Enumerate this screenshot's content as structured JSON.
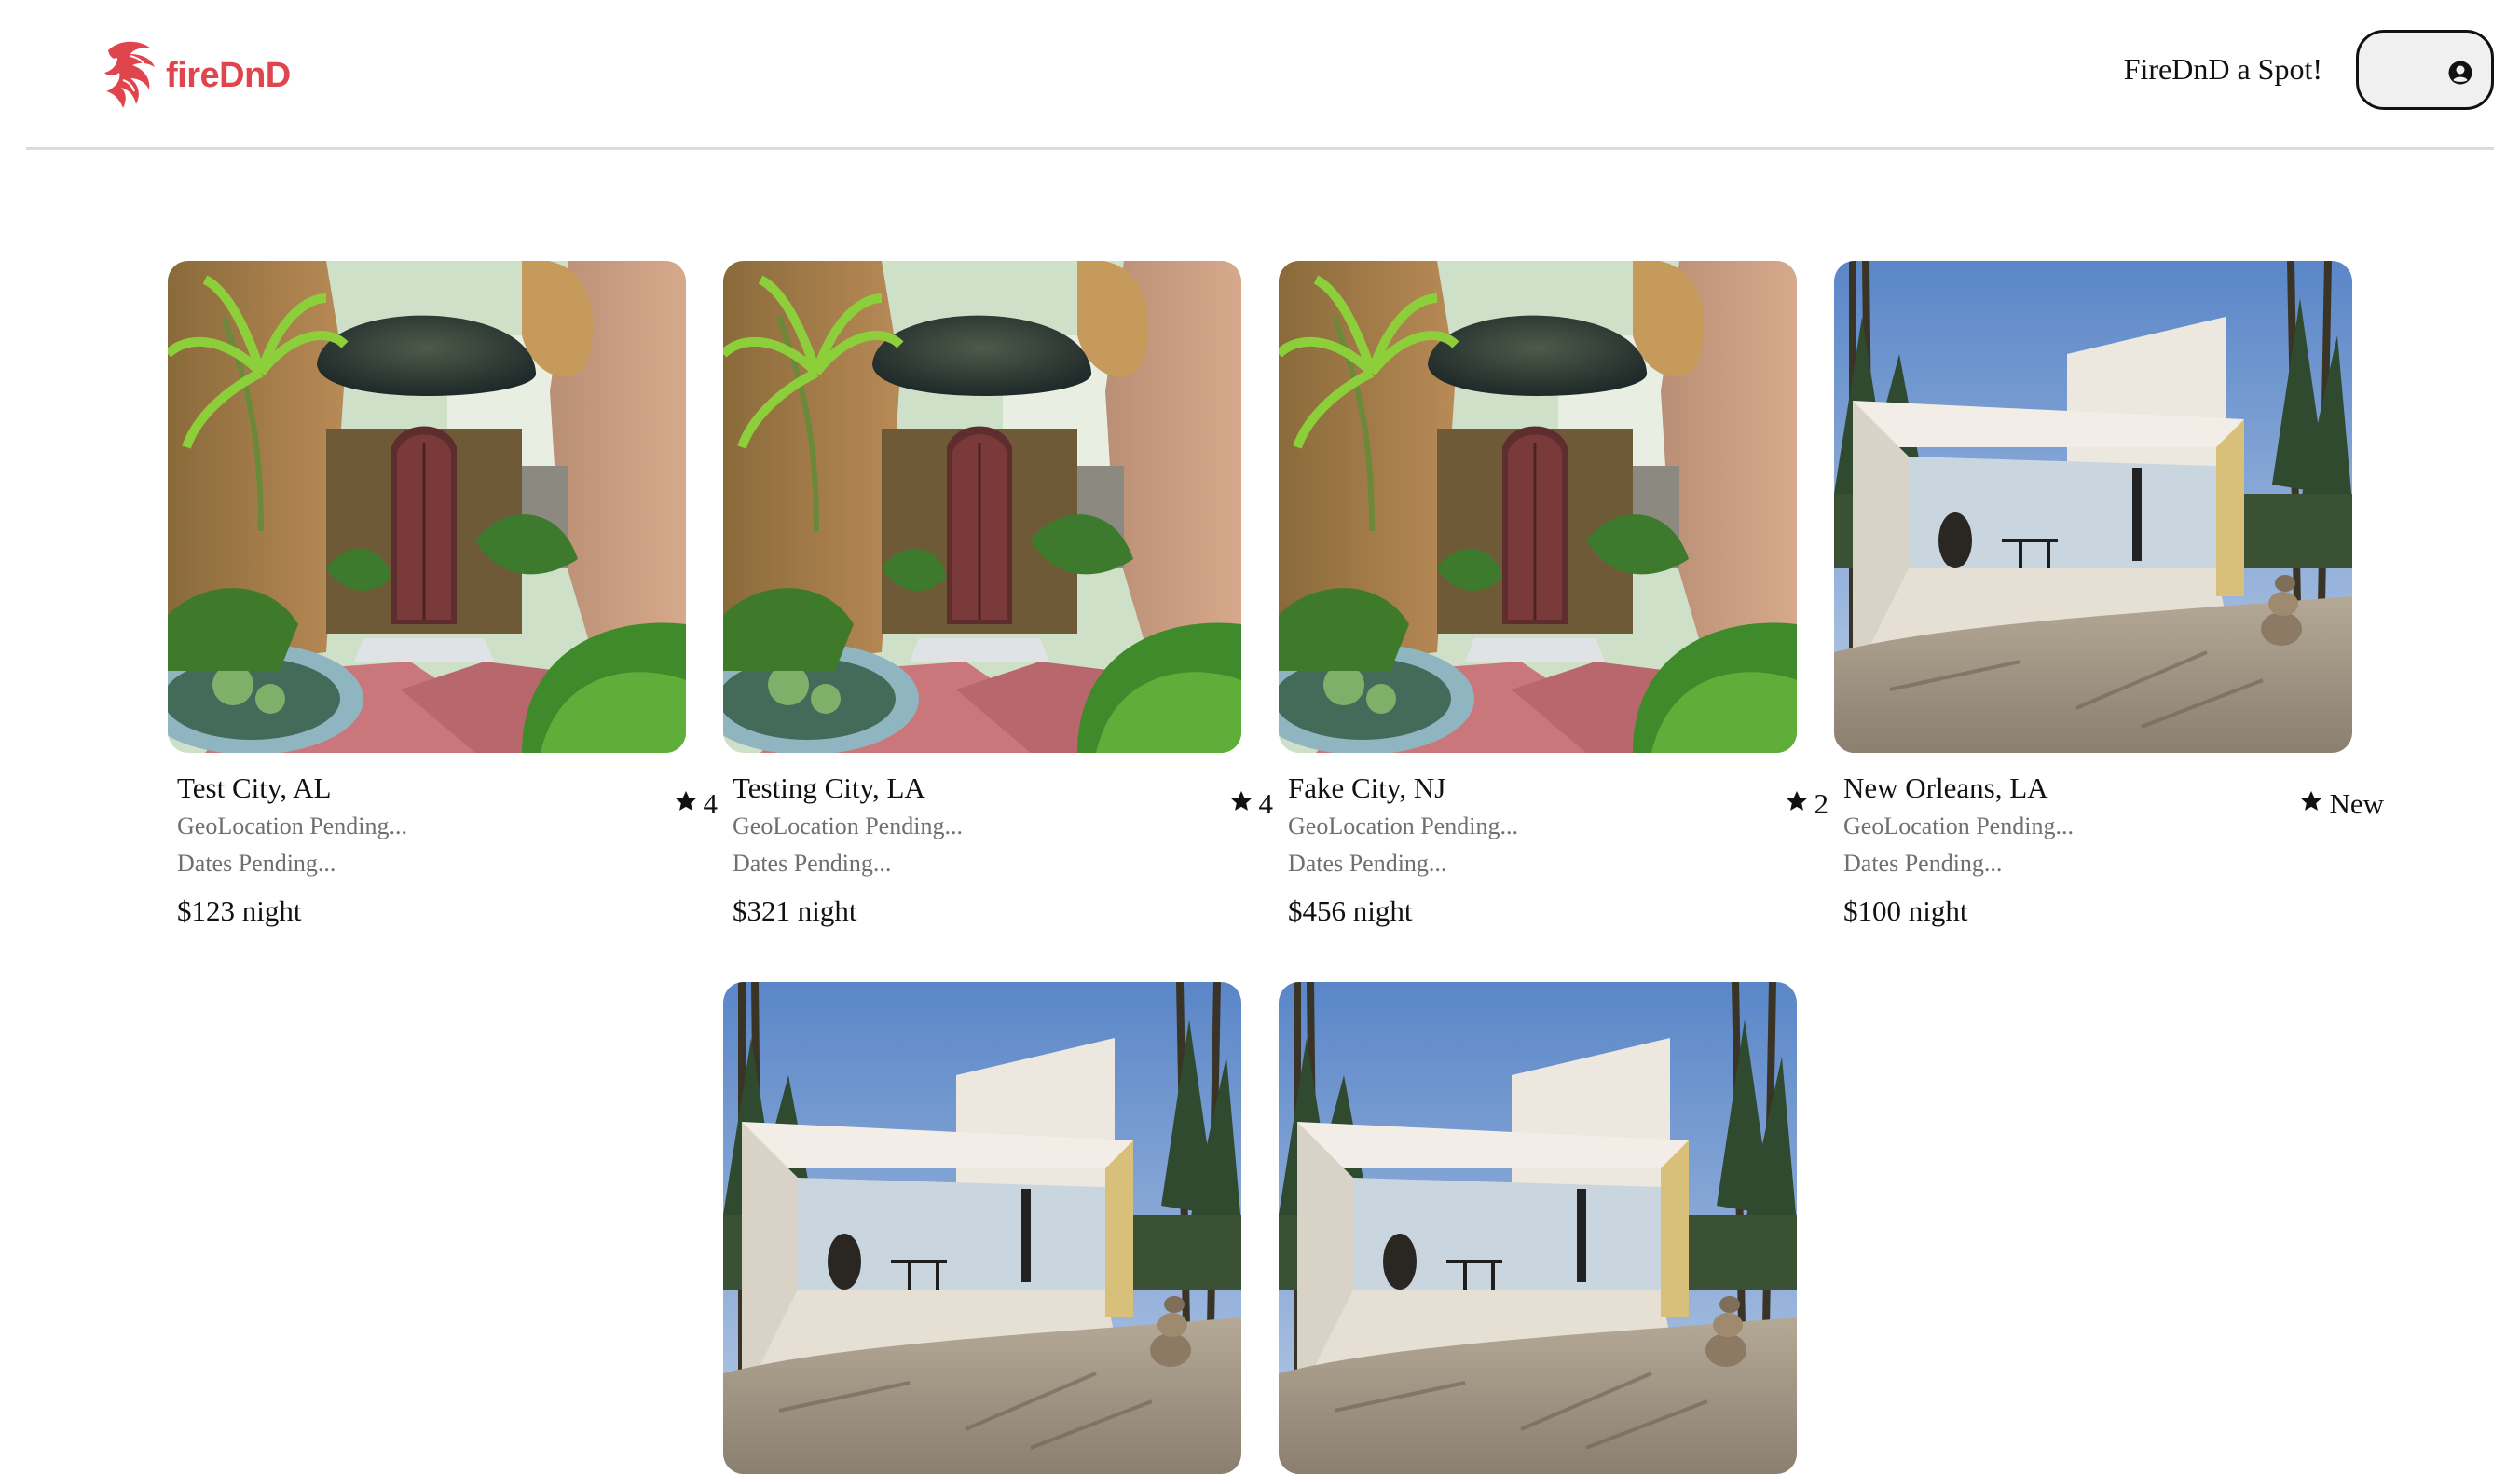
{
  "header": {
    "logo_text": "fireDnD",
    "host_link": "FireDnD a Spot!",
    "profile_icon": "user-circle-icon",
    "brand_color": "#e0444c"
  },
  "listings": [
    {
      "city": "Test City, AL",
      "rating": "4",
      "geo": "GeoLocation Pending...",
      "dates": "Dates Pending...",
      "price": "$123 night",
      "photo": "mushroom-house"
    },
    {
      "city": "Testing City, LA",
      "rating": "4",
      "geo": "GeoLocation Pending...",
      "dates": "Dates Pending...",
      "price": "$321 night",
      "photo": "mushroom-house"
    },
    {
      "city": "Fake City, NJ",
      "rating": "2",
      "geo": "GeoLocation Pending...",
      "dates": "Dates Pending...",
      "price": "$456 night",
      "photo": "mushroom-house"
    },
    {
      "city": "New Orleans, LA",
      "rating": "New",
      "geo": "GeoLocation Pending...",
      "dates": "Dates Pending...",
      "price": "$100 night",
      "photo": "modern-cabin"
    },
    {
      "photo": "modern-cabin"
    },
    {
      "photo": "modern-cabin"
    }
  ]
}
